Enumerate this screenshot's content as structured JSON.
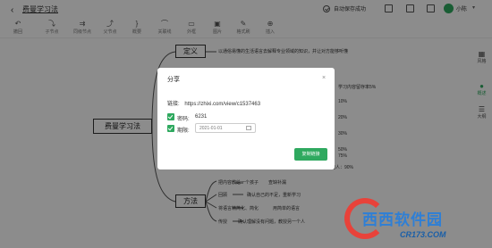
{
  "header": {
    "title": "费曼学习法",
    "save_status": "自动保存成功",
    "username": "小陈"
  },
  "toolbar": {
    "items": [
      {
        "label": "撤回",
        "icon": "undo-icon"
      },
      {
        "label": "子节点",
        "icon": "child-node-icon"
      },
      {
        "label": "同级节点",
        "icon": "sibling-node-icon"
      },
      {
        "label": "父节点",
        "icon": "parent-node-icon"
      },
      {
        "label": "概要",
        "icon": "summary-icon"
      },
      {
        "label": "关联线",
        "icon": "relation-icon"
      },
      {
        "label": "外框",
        "icon": "frame-icon"
      },
      {
        "label": "图片",
        "icon": "image-icon"
      },
      {
        "label": "格式刷",
        "icon": "brush-icon"
      },
      {
        "label": "插入",
        "icon": "insert-icon"
      }
    ]
  },
  "side_panel": {
    "items": [
      {
        "label": "风格",
        "icon": "style-icon"
      },
      {
        "label": "概述",
        "icon": "outline-icon"
      },
      {
        "label": "大纲",
        "icon": "list-icon"
      }
    ]
  },
  "mindmap": {
    "root": "费曼学习法",
    "branches": [
      "定义",
      "方法"
    ],
    "topics": [
      "以通俗易懂的生活语言去解释专业领域的知识，并让对方能够听懂",
      "学习内容留存率5%",
      "10%",
      "20%",
      "30%",
      "50%",
      "75%",
      "教授他人：90%",
      "把内容教给一个孩子",
      "查缺补漏",
      "简化语言",
      "回顾",
      "确认自己的不足，重新学习",
      "将语言精简化、简化",
      "用简单的语言",
      "传授",
      "确认理解没有问题，教授另一个人"
    ]
  },
  "dialog": {
    "title": "分享",
    "link_label": "链接:",
    "link_url": "https://zhixi.com/view/c1537463",
    "password_label": "密码:",
    "password_value": "6231",
    "expiry_label": "期限:",
    "expiry_placeholder": "2021-01-01",
    "copy_button": "复制链接"
  },
  "watermark": {
    "text": "西西软件园",
    "url": "CR173.COM"
  },
  "colors": {
    "accent": "#2fa95f",
    "overlay": "rgba(0,0,0,0.45)"
  }
}
